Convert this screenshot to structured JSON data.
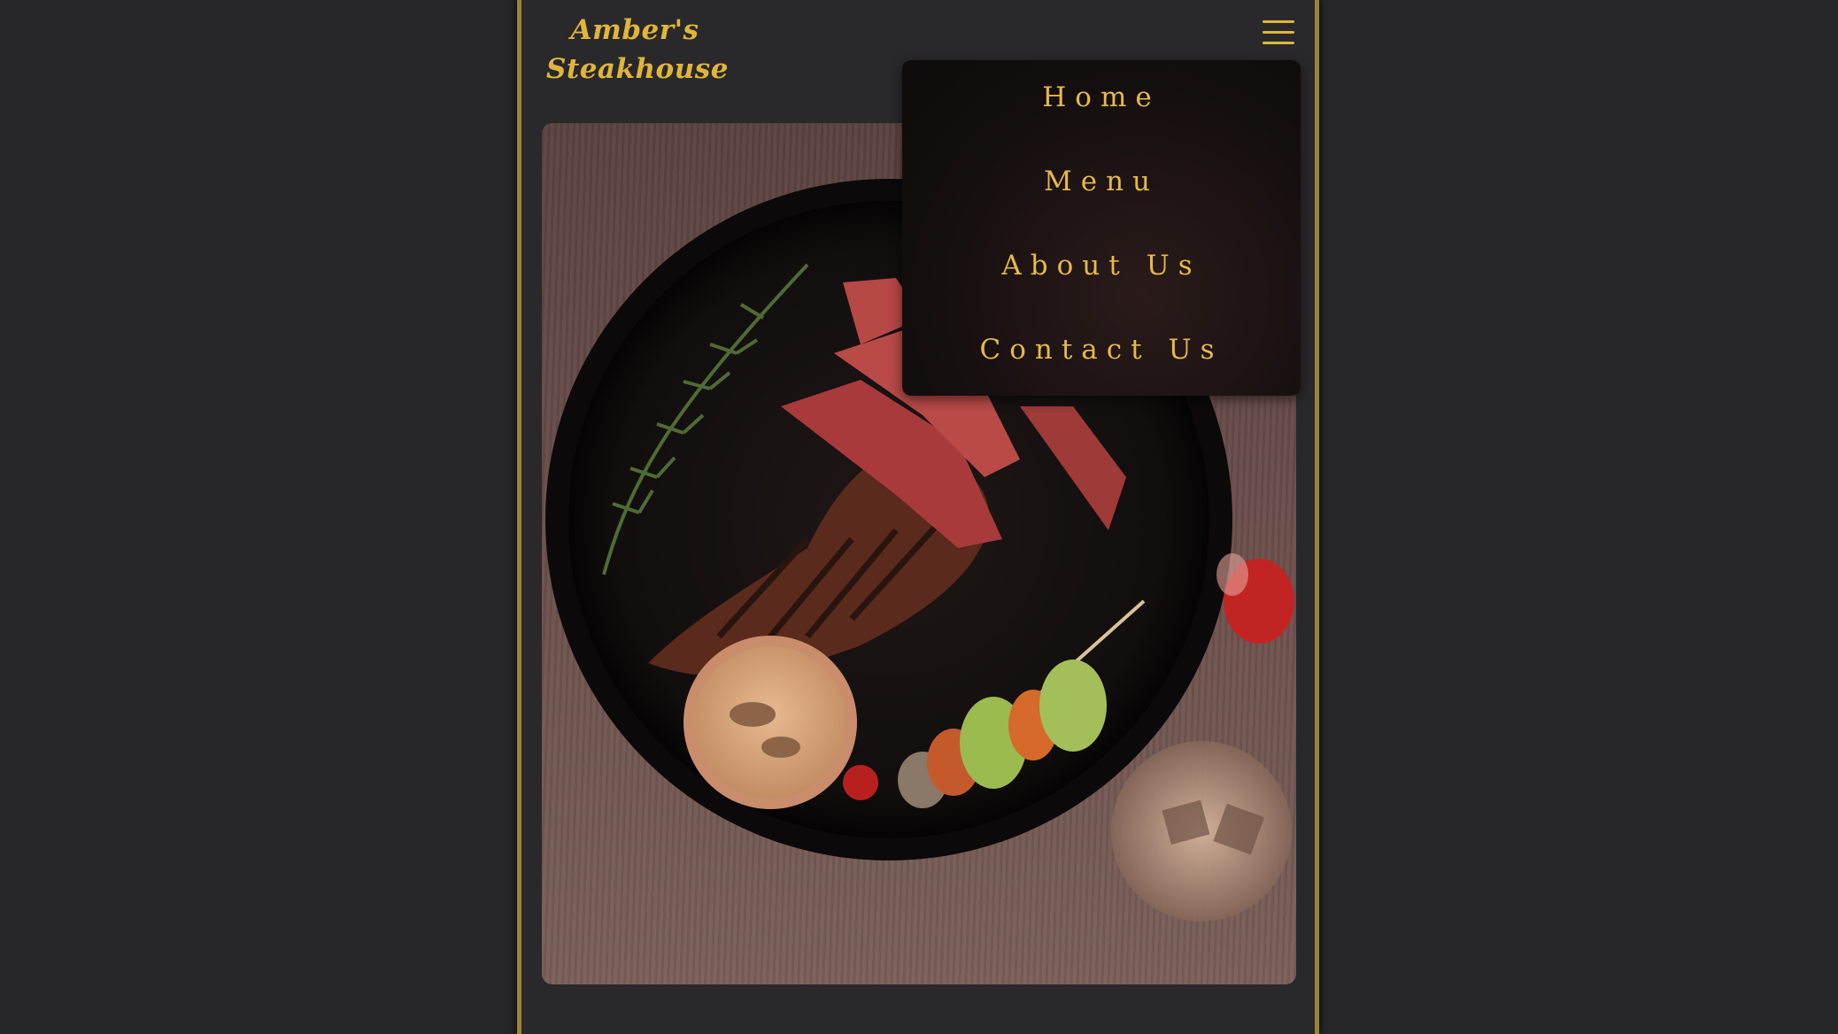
{
  "brand": {
    "line1": "Amber's",
    "line2": "Steakhouse"
  },
  "nav": {
    "menu_icon": "hamburger-icon",
    "items": [
      {
        "label": "Home"
      },
      {
        "label": "Menu"
      },
      {
        "label": "About Us"
      },
      {
        "label": "Contact Us"
      }
    ]
  },
  "hero": {
    "image": "steak-on-cast-iron-plate-photo"
  },
  "colors": {
    "accent": "#e0b53a",
    "border": "#9c8436",
    "background": "#262628"
  }
}
